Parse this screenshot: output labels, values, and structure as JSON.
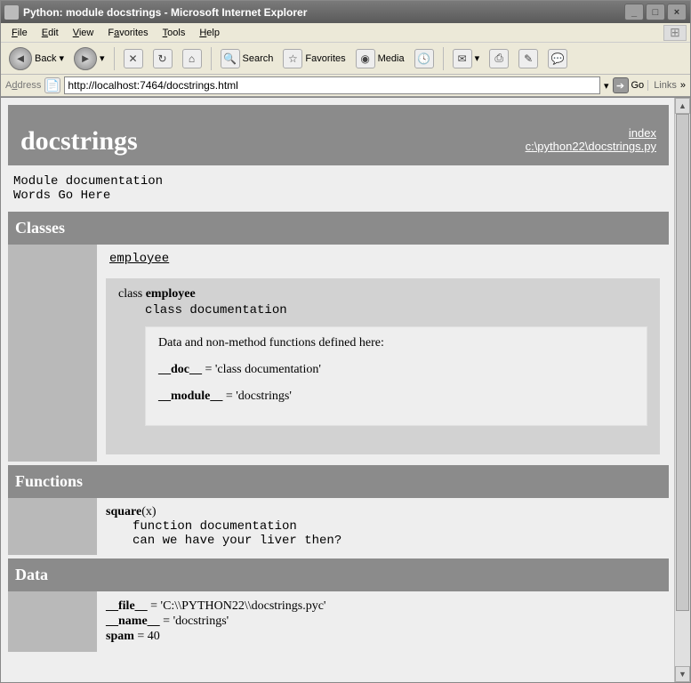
{
  "titlebar": "Python: module docstrings - Microsoft Internet Explorer",
  "menu": [
    "File",
    "Edit",
    "View",
    "Favorites",
    "Tools",
    "Help"
  ],
  "toolbar": {
    "back": "Back",
    "search": "Search",
    "favorites": "Favorites",
    "media": "Media"
  },
  "address": {
    "label": "Address",
    "url": "http://localhost:7464/docstrings.html",
    "go": "Go",
    "links": "Links"
  },
  "pydoc": {
    "title": "docstrings",
    "index_label": "index",
    "file_path": "c:\\python22\\docstrings.py",
    "module_doc": "Module documentation\nWords Go Here",
    "classes_header": "Classes",
    "class_link": "employee",
    "class_label": "class ",
    "class_name": "employee",
    "class_doc": "class documentation",
    "inner_header": "Data and non-method functions defined here:",
    "dunder_doc_label": "__doc__",
    "dunder_doc_val": " = 'class documentation'",
    "dunder_module_label": "__module__",
    "dunder_module_val": " = 'docstrings'",
    "functions_header": "Functions",
    "fn_name": "square",
    "fn_args": "(x)",
    "fn_doc": "function documentation\ncan we have your liver then?",
    "data_header": "Data",
    "data_file_label": "__file__",
    "data_file_val": " = 'C:\\\\PYTHON22\\\\docstrings.pyc'",
    "data_name_label": "__name__",
    "data_name_val": " = 'docstrings'",
    "data_spam_label": "spam",
    "data_spam_val": " = 40"
  }
}
